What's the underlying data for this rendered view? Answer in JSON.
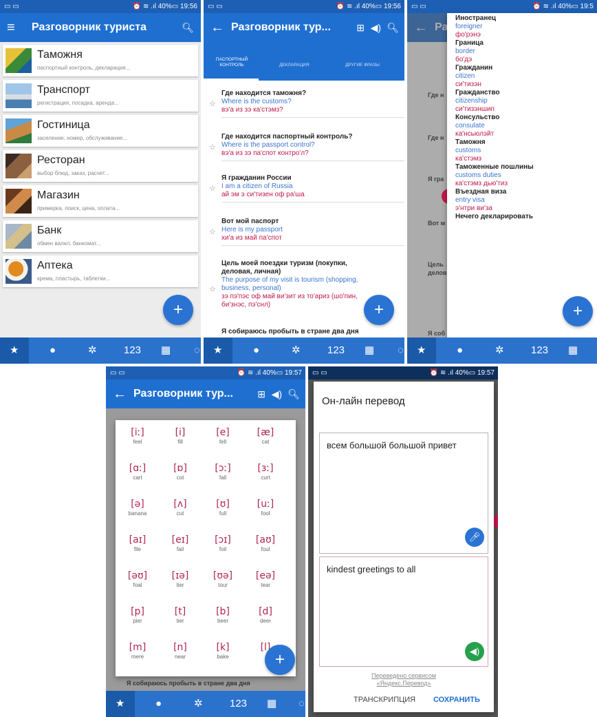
{
  "status": {
    "left_icons": "▭ ▭",
    "right": "⏰ ≋ .ıl 40%▭ ",
    "time_1": "19:56",
    "time_2": "19:56",
    "time_3": "19:5",
    "time_4": "19:57",
    "time_5": "19:57"
  },
  "appbar": {
    "title_full": "Разговорник туриста",
    "title_short": "Разговорник тур..."
  },
  "screen1": {
    "categories": [
      {
        "title": "Таможня",
        "sub": "паспортный контроль, декларация..."
      },
      {
        "title": "Транспорт",
        "sub": "регистрация, посадка, аренда..."
      },
      {
        "title": "Гостиница",
        "sub": "заселение, номер, обслуживание..."
      },
      {
        "title": "Ресторан",
        "sub": "выбор блюд, заказ, расчет..."
      },
      {
        "title": "Магазин",
        "sub": "примерка, поиск, цена, оплата..."
      },
      {
        "title": "Банк",
        "sub": "обмен валют, банкомат..."
      },
      {
        "title": "Аптека",
        "sub": "крема, пластырь, таблетки..."
      }
    ]
  },
  "screen2": {
    "tabs": [
      "ПАСПОРТНЫЙ КОНТРОЛЬ",
      "ДЕКЛАРАЦИЯ",
      "ДРУГИЕ ФРАЗЫ"
    ],
    "phrases": [
      {
        "ru": "Где находится таможня?",
        "en": "Where is the customs?",
        "tr": "вэ'а из зэ ка'стэмз?"
      },
      {
        "ru": "Где находится паспортный контроль?",
        "en": "Where is the passport control?",
        "tr": "вэ'а из зэ па'спот контро'л?"
      },
      {
        "ru": "Я гражданин России",
        "en": "I am a citizen of Russia",
        "tr": "ай эм э си'тизен оф ра'ша"
      },
      {
        "ru": "Вот мой паспорт",
        "en": "Here is my passport",
        "tr": "хи'а из май па'спот"
      },
      {
        "ru": "Цель моей поездки туризм (покупки, деловая, личная)",
        "en": "The purpose of my visit is tourism (shopping, business, personal)",
        "tr": "зэ пэ'пэс оф май ви'зит из то'ариз (шо'пин, би'знэс, пэ'снл)"
      },
      {
        "ru": "Я собираюсь пробыть в стране два дня",
        "en": "",
        "tr": ""
      }
    ]
  },
  "screen3": {
    "vocab": [
      {
        "ru": "Иностранец",
        "en": "foreigner",
        "tr": "фо'рэнэ"
      },
      {
        "ru": "Граница",
        "en": "border",
        "tr": "бо'дэ"
      },
      {
        "ru": "Гражданин",
        "en": "citizen",
        "tr": "си'тизэн"
      },
      {
        "ru": "Гражданство",
        "en": "citizenship",
        "tr": "си'тизэншип"
      },
      {
        "ru": "Консульство",
        "en": "consulate",
        "tr": "ка'нсьюлэйт"
      },
      {
        "ru": "Таможня",
        "en": "customs",
        "tr": "ка'стэмз"
      },
      {
        "ru": "Таможенные пошлины",
        "en": "customs duties",
        "tr": "ка'стэмз дью'тиз"
      },
      {
        "ru": "Въездная виза",
        "en": "entry visa",
        "tr": "э'нтри ви'за"
      },
      {
        "ru": "Нечего декларировать",
        "en": "",
        "tr": ""
      }
    ],
    "bg_labels": [
      "Где н",
      "Где н",
      "Я гра",
      "Вот м",
      "Цель",
      "делов",
      "Я соб"
    ]
  },
  "screen4": {
    "phonemes": [
      {
        "s": "[iː]",
        "w": "feel"
      },
      {
        "s": "[i]",
        "w": "fill"
      },
      {
        "s": "[e]",
        "w": "fell"
      },
      {
        "s": "[æ]",
        "w": "cat"
      },
      {
        "s": "[ɑː]",
        "w": "cart"
      },
      {
        "s": "[ɒ]",
        "w": "cot"
      },
      {
        "s": "[ɔː]",
        "w": "fall"
      },
      {
        "s": "[ɜː]",
        "w": "curt"
      },
      {
        "s": "[ə]",
        "w": "banana"
      },
      {
        "s": "[ʌ]",
        "w": "cut"
      },
      {
        "s": "[ʊ]",
        "w": "full"
      },
      {
        "s": "[uː]",
        "w": "fool"
      },
      {
        "s": "[aɪ]",
        "w": "file"
      },
      {
        "s": "[eɪ]",
        "w": "fail"
      },
      {
        "s": "[ɔɪ]",
        "w": "foil"
      },
      {
        "s": "[aʊ]",
        "w": "foul"
      },
      {
        "s": "[əʊ]",
        "w": "foal"
      },
      {
        "s": "[ɪə]",
        "w": "tier"
      },
      {
        "s": "[ʊə]",
        "w": "tour"
      },
      {
        "s": "[eə]",
        "w": "tear"
      },
      {
        "s": "[p]",
        "w": "pier"
      },
      {
        "s": "[t]",
        "w": "tier"
      },
      {
        "s": "[b]",
        "w": "beer"
      },
      {
        "s": "[d]",
        "w": "deer"
      },
      {
        "s": "[m]",
        "w": "mere"
      },
      {
        "s": "[n]",
        "w": "near"
      },
      {
        "s": "[k]",
        "w": "bake"
      },
      {
        "s": "[l]",
        "w": ""
      }
    ],
    "bottom_text": "Я собираюсь пробыть в стране два дня"
  },
  "screen5": {
    "dialog_title": "Он-лайн перевод",
    "input_text": "всем большой большой привет",
    "output_text": "kindest greetings to all",
    "credit_line1": "Переведено сервисом",
    "credit_line2": "«Яндекс.Перевод»",
    "btn_transcription": "ТРАНСКРИПЦИЯ",
    "btn_save": "СОХРАНИТЬ"
  },
  "nav": {
    "num_label": "123"
  },
  "colors": {
    "appbar": "#1f6fd0",
    "nav": "#2b72cc",
    "translit": "#c0194a",
    "english": "#3a75d0",
    "fab": "#2a73d3",
    "mic_blue": "#2a73d3",
    "speaker_green": "#26a04a"
  }
}
